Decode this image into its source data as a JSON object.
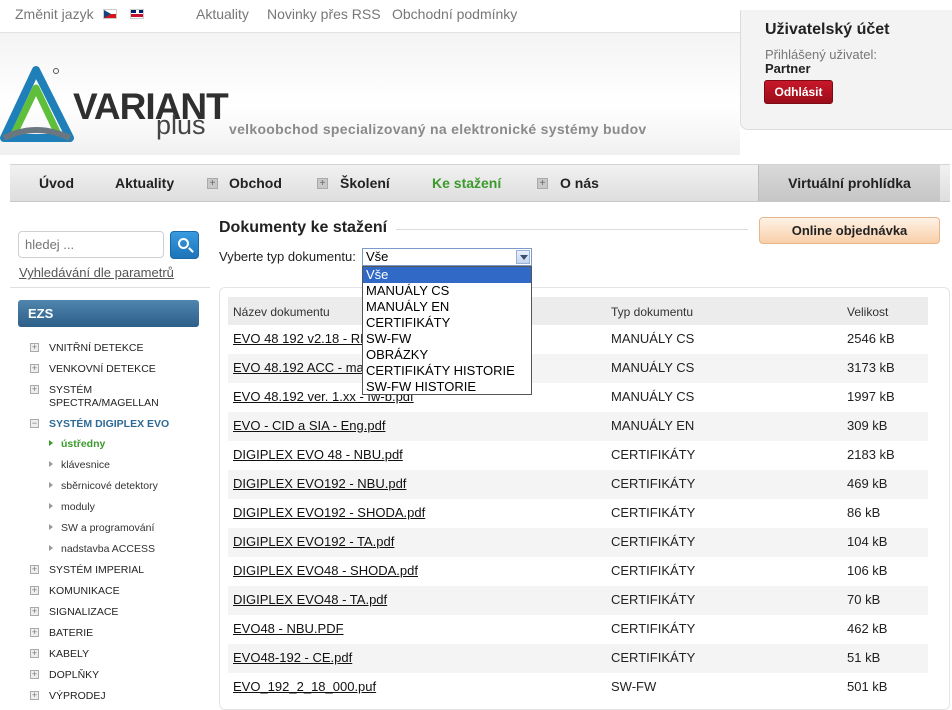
{
  "topbar": {
    "change_language": "Změnit jazyk",
    "links": [
      "Aktuality",
      "Novinky přes RSS",
      "Obchodní podmínky"
    ]
  },
  "logo": {
    "word": "VARIANT",
    "sub": "plus",
    "slogan": "velkoobchod specializovaný na elektronické systémy budov"
  },
  "account": {
    "title": "Uživatelský účet",
    "logged_label": "Přihlášený uživatel:",
    "user": "Partner",
    "logout": "Odhlásit"
  },
  "nav": {
    "items": [
      "Úvod",
      "Aktuality",
      "Obchod",
      "Školení",
      "Ke stažení",
      "O nás"
    ],
    "active": "Ke stažení",
    "virtual_tour": "Virtuální prohlídka"
  },
  "sidebar": {
    "search_placeholder": "hledej ...",
    "param_search": "Vyhledávání dle parametrů",
    "section": "EZS",
    "categories": [
      "VNITŘNÍ DETEKCE",
      "VENKOVNÍ DETEKCE",
      "SYSTÉM",
      "SPECTRA/MAGELLAN",
      "SYSTÉM DIGIPLEX EVO",
      "SYSTÉM IMPERIAL",
      "KOMUNIKACE",
      "SIGNALIZACE",
      "BATERIE",
      "KABELY",
      "DOPLŇKY",
      "VÝPRODEJ"
    ],
    "subitems": [
      "ústředny",
      "klávesnice",
      "sběrnicové detektory",
      "moduly",
      "SW a programování",
      "nadstavba ACCESS"
    ]
  },
  "main": {
    "title": "Dokumenty ke stažení",
    "order_button": "Online objednávka",
    "filter_label": "Vyberte typ dokumentu:",
    "filter_value": "Vše",
    "options": [
      "Vše",
      "MANUÁLY CS",
      "MANUÁLY EN",
      "CERTIFIKÁTY",
      "SW-FW",
      "OBRÁZKY",
      "CERTIFIKÁTY HISTORIE",
      "SW-FW HISTORIE"
    ],
    "columns": [
      "Název dokumentu",
      "Typ dokumentu",
      "Velikost"
    ],
    "rows": [
      {
        "name": "EVO 48 192 v2.18 - RP",
        "type": "MANUÁLY CS",
        "size": "2546 kB"
      },
      {
        "name": "EVO 48.192 ACC - ma",
        "type": "MANUÁLY CS",
        "size": "3173 kB"
      },
      {
        "name": "EVO 48.192 ver. 1.xx - fw-b.pdf",
        "type": "MANUÁLY CS",
        "size": "1997 kB"
      },
      {
        "name": "EVO - CID a SIA - Eng.pdf",
        "type": "MANUÁLY EN",
        "size": "309 kB"
      },
      {
        "name": "DIGIPLEX EVO 48 - NBU.pdf",
        "type": "CERTIFIKÁTY",
        "size": "2183 kB"
      },
      {
        "name": "DIGIPLEX EVO192 - NBU.pdf",
        "type": "CERTIFIKÁTY",
        "size": "469 kB"
      },
      {
        "name": "DIGIPLEX EVO192 - SHODA.pdf",
        "type": "CERTIFIKÁTY",
        "size": "86 kB"
      },
      {
        "name": "DIGIPLEX EVO192 - TA.pdf",
        "type": "CERTIFIKÁTY",
        "size": "104 kB"
      },
      {
        "name": "DIGIPLEX EVO48 - SHODA.pdf",
        "type": "CERTIFIKÁTY",
        "size": "106 kB"
      },
      {
        "name": "DIGIPLEX EVO48 - TA.pdf",
        "type": "CERTIFIKÁTY",
        "size": "70 kB"
      },
      {
        "name": "EVO48 - NBU.PDF",
        "type": "CERTIFIKÁTY",
        "size": "462 kB"
      },
      {
        "name": "EVO48-192 - CE.pdf",
        "type": "CERTIFIKÁTY",
        "size": "51 kB"
      },
      {
        "name": "EVO_192_2_18_000.puf",
        "type": "SW-FW",
        "size": "501 kB"
      }
    ]
  },
  "colors": {
    "accent_green": "#3c9a2c",
    "logout_red": "#b01020",
    "ezs_blue": "#3a6d96",
    "dropdown_highlight": "#3169c6"
  }
}
